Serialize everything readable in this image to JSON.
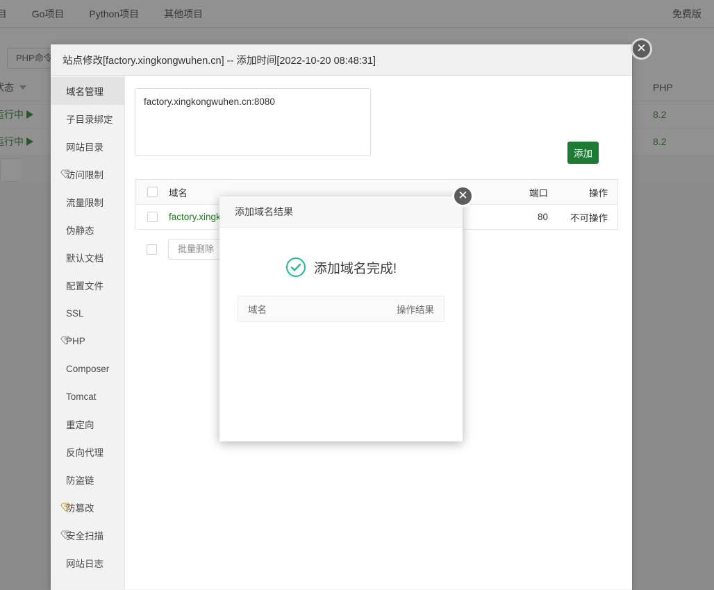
{
  "top_nav": {
    "tabs": [
      {
        "label": "e项目"
      },
      {
        "label": "Go项目"
      },
      {
        "label": "Python项目"
      },
      {
        "label": "其他项目"
      }
    ],
    "free_badge": "免费版"
  },
  "app_toolbar": {
    "php_cli_label": "PHP命令行"
  },
  "background_table": {
    "status_header": "状态",
    "php_header": "PHP",
    "rows": [
      {
        "status": "运行中",
        "php": "8.2"
      },
      {
        "status": "运行中",
        "php": "8.2"
      }
    ]
  },
  "site_dialog": {
    "title": "站点修改[factory.xingkongwuhen.cn] -- 添加时间[2022-10-20 08:48:31]",
    "close_label": "✕",
    "sidebar": [
      {
        "label": "域名管理",
        "gem": null,
        "active": true
      },
      {
        "label": "子目录绑定",
        "gem": null,
        "active": false
      },
      {
        "label": "网站目录",
        "gem": null,
        "active": false
      },
      {
        "label": "访问限制",
        "gem": "gray",
        "active": false
      },
      {
        "label": "流量限制",
        "gem": null,
        "active": false
      },
      {
        "label": "伪静态",
        "gem": null,
        "active": false
      },
      {
        "label": "默认文档",
        "gem": null,
        "active": false
      },
      {
        "label": "配置文件",
        "gem": null,
        "active": false
      },
      {
        "label": "SSL",
        "gem": null,
        "active": false
      },
      {
        "label": "PHP",
        "gem": "gray",
        "active": false
      },
      {
        "label": "Composer",
        "gem": null,
        "active": false
      },
      {
        "label": "Tomcat",
        "gem": null,
        "active": false
      },
      {
        "label": "重定向",
        "gem": null,
        "active": false
      },
      {
        "label": "反向代理",
        "gem": null,
        "active": false
      },
      {
        "label": "防盗链",
        "gem": null,
        "active": false
      },
      {
        "label": "防篡改",
        "gem": "gold",
        "active": false
      },
      {
        "label": "安全扫描",
        "gem": "gray",
        "active": false
      },
      {
        "label": "网站日志",
        "gem": null,
        "active": false
      }
    ],
    "domain_input_value": "factory.xingkongwuhen.cn:8080",
    "domain_input_placeholder": "",
    "add_button_label": "添加",
    "table": {
      "headers": {
        "domain": "域名",
        "port": "端口",
        "operation": "操作"
      },
      "rows": [
        {
          "domain": "factory.xingkongwuhen.cn",
          "port": "80",
          "operation": "不可操作"
        }
      ]
    },
    "batch_delete_label": "批量删除"
  },
  "result_modal": {
    "title": "添加域名结果",
    "close_label": "✕",
    "success_text": "添加域名完成!",
    "check_icon": "check-circle-icon",
    "table_headers": {
      "domain": "域名",
      "status": "操作结果"
    },
    "rows": []
  },
  "colors": {
    "accent_green": "#1e7b34",
    "success_teal": "#22b79a",
    "gem_gold": "#d7a123",
    "gem_gray": "#8a8a8a",
    "dialog_bg": "#f0f0f0"
  }
}
